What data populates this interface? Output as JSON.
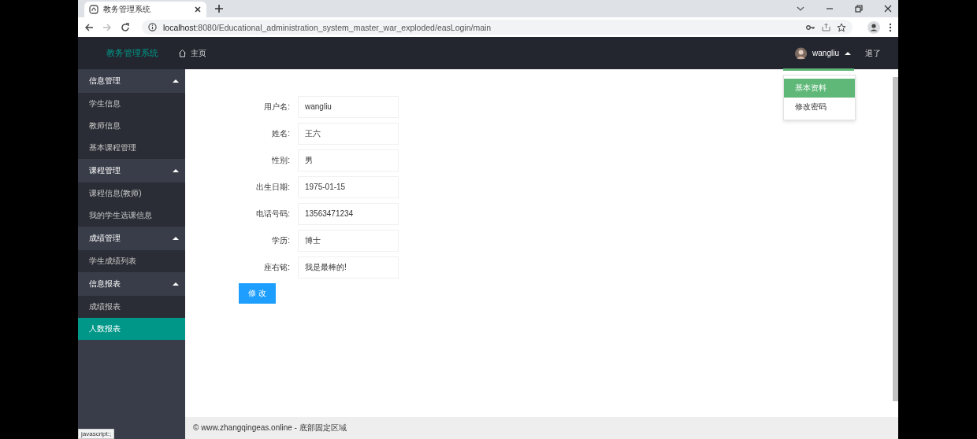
{
  "browser": {
    "tab_title": "教务管理系统",
    "url_host": "localhost",
    "url_rest": ":8080/Educational_administration_system_master_war_exploded/easLogin/main",
    "status_tooltip": "javascript:;"
  },
  "header": {
    "logo": "教务管理系统",
    "home": "主页",
    "username": "wangliu",
    "logout": "退了"
  },
  "user_menu": [
    {
      "label": "基本资料",
      "selected": true
    },
    {
      "label": "修改密码",
      "selected": false
    }
  ],
  "sidebar": {
    "groups": [
      {
        "label": "信息管理",
        "expanded": true,
        "items": [
          {
            "label": "学生信息",
            "selected": false
          },
          {
            "label": "教师信息",
            "selected": false
          },
          {
            "label": "基本课程管理",
            "selected": false
          }
        ]
      },
      {
        "label": "课程管理",
        "expanded": true,
        "items": [
          {
            "label": "课程信息(教师)",
            "selected": false
          },
          {
            "label": "我的学生选课信息",
            "selected": false
          }
        ]
      },
      {
        "label": "成绩管理",
        "expanded": true,
        "items": [
          {
            "label": "学生成绩列表",
            "selected": false
          }
        ]
      },
      {
        "label": "信息报表",
        "expanded": true,
        "items": [
          {
            "label": "成绩报表",
            "selected": false
          },
          {
            "label": "人数报表",
            "selected": true
          }
        ]
      }
    ]
  },
  "form": {
    "fields": [
      {
        "label": "用户名:",
        "value": "wangliu"
      },
      {
        "label": "姓名:",
        "value": "王六"
      },
      {
        "label": "性别:",
        "value": "男"
      },
      {
        "label": "出生日期:",
        "value": "1975-01-15"
      },
      {
        "label": "电话号码:",
        "value": "13563471234"
      },
      {
        "label": "学历:",
        "value": "博士"
      },
      {
        "label": "座右铭:",
        "value": "我是最棒的!"
      }
    ],
    "submit": "修 改"
  },
  "footer": "© www.zhangqingeas.online - 底部固定区域"
}
